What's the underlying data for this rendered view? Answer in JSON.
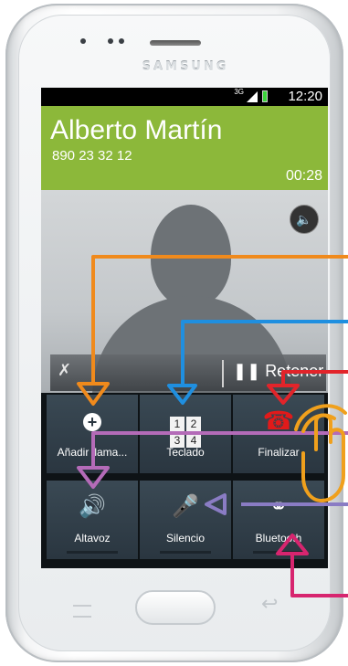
{
  "device": {
    "brand": "SAMSUNG"
  },
  "status_bar": {
    "network": "3G",
    "time": "12:20"
  },
  "call": {
    "caller_name": "Alberto Martín",
    "caller_number": "890 23 32 12",
    "duration": "00:28"
  },
  "callbar": {
    "hold_label": "Retener"
  },
  "buttons": {
    "add_call": "Añadir llama...",
    "keypad": "Teclado",
    "end": "Finalizar",
    "speaker": "Altavoz",
    "mute": "Silencio",
    "bluetooth": "Bluetooth"
  },
  "keypad_digits": [
    "1",
    "2",
    "3",
    "4"
  ],
  "annotation_colors": {
    "add_call": "#f08a1c",
    "keypad": "#1f8fe0",
    "end": "#e2242a",
    "speaker": "#b46bb8",
    "mute": "#8a7cc4",
    "bluetooth": "#d7256f",
    "gesture_hand": "#f0a01c"
  }
}
